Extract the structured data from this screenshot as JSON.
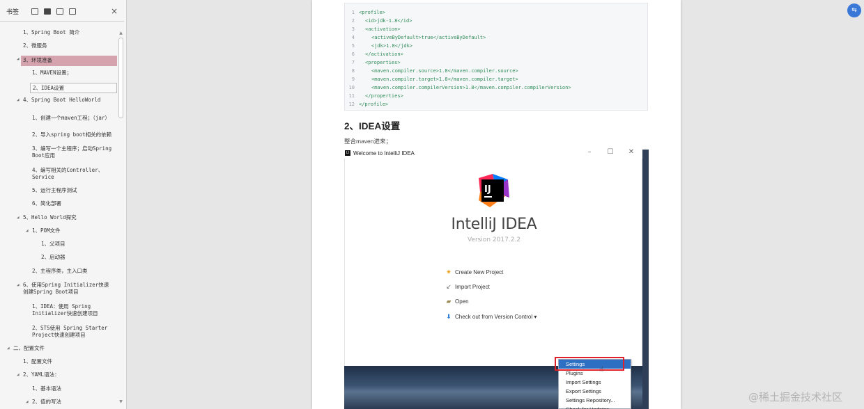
{
  "sidebar": {
    "title": "书签",
    "tools": [
      "expand-all-icon",
      "bookmark-icon",
      "add-bookmark-icon",
      "bookmark-options-icon"
    ],
    "close": "×",
    "bookmarks": [
      {
        "text": "1、Spring Boot 简介",
        "level": 2
      },
      {
        "text": "2、微服务",
        "level": 2
      },
      {
        "text": "3、环境准备",
        "level": 2,
        "selected": true,
        "toggle": true
      },
      {
        "text": "1、MAVEN设置；",
        "level": 3
      },
      {
        "text": "2、IDEA设置",
        "level": 3,
        "boxed": true
      },
      {
        "text": "4、Spring Boot HelloWorld",
        "level": 2,
        "toggle": true
      },
      {
        "text": "1、创建一个maven工程；（jar）",
        "level": 3
      },
      {
        "text": "2、导入spring boot相关的依赖",
        "level": 3
      },
      {
        "text": "3、编写一个主程序；启动Spring Boot应用",
        "level": 3
      },
      {
        "text": "4、编写相关的Controller、Service",
        "level": 3
      },
      {
        "text": "5、运行主程序测试",
        "level": 3
      },
      {
        "text": "6、简化部署",
        "level": 3
      },
      {
        "text": "5、Hello World探究",
        "level": 2,
        "toggle": true
      },
      {
        "text": "1、POM文件",
        "level": 3,
        "toggle": true
      },
      {
        "text": "1、父项目",
        "level": 4
      },
      {
        "text": "2、启动器",
        "level": 4
      },
      {
        "text": "2、主程序类，主入口类",
        "level": 3
      },
      {
        "text": "6、使用Spring Initializer快速创建Spring Boot项目",
        "level": 2,
        "toggle": true
      },
      {
        "text": "1、IDEA：使用 Spring Initializer快速创建项目",
        "level": 3
      },
      {
        "text": "2、STS使用 Spring Starter Project快速创建项目",
        "level": 3
      },
      {
        "text": "二、配置文件",
        "level": 1,
        "toggle": true
      },
      {
        "text": "1、配置文件",
        "level": 2
      },
      {
        "text": "2、YAML语法：",
        "level": 2,
        "toggle": true
      },
      {
        "text": "1、基本语法",
        "level": 3
      },
      {
        "text": "2、值的写法",
        "level": 3,
        "toggle": true
      }
    ]
  },
  "doc": {
    "code_lines": [
      {
        "n": "1",
        "t": "<profile>",
        "indent": 0
      },
      {
        "n": "2",
        "t": "<id>jdk-1.8</id>",
        "indent": 1
      },
      {
        "n": "3",
        "t": "<activation>",
        "indent": 1
      },
      {
        "n": "4",
        "t": "<activeByDefault>true</activeByDefault>",
        "indent": 2
      },
      {
        "n": "5",
        "t": "<jdk>1.8</jdk>",
        "indent": 2
      },
      {
        "n": "6",
        "t": "</activation>",
        "indent": 1
      },
      {
        "n": "7",
        "t": "<properties>",
        "indent": 1
      },
      {
        "n": "8",
        "t": "<maven.compiler.source>1.8</maven.compiler.source>",
        "indent": 2
      },
      {
        "n": "9",
        "t": "<maven.compiler.target>1.8</maven.compiler.target>",
        "indent": 2
      },
      {
        "n": "10",
        "t": "<maven.compiler.compilerVersion>1.8</maven.compiler.compilerVersion>",
        "indent": 2
      },
      {
        "n": "11",
        "t": "</properties>",
        "indent": 1
      },
      {
        "n": "12",
        "t": "</profile>",
        "indent": 0
      }
    ],
    "heading": "2、IDEA设置",
    "paragraph": "整合maven进来；"
  },
  "idea": {
    "window_title": "Welcome to IntelliJ IDEA",
    "logo_text": "IJ",
    "product_name": "IntelliJ IDEA",
    "version": "Version 2017.2.2",
    "actions": [
      {
        "icon": "sun-icon",
        "glyph": "✷",
        "color": "#e8a21a",
        "label": "Create New Project"
      },
      {
        "icon": "import-icon",
        "glyph": "↙",
        "color": "#666666",
        "label": "Import Project"
      },
      {
        "icon": "folder-icon",
        "glyph": "▰",
        "color": "#9a8a55",
        "label": "Open"
      },
      {
        "icon": "arrow-down-icon",
        "glyph": "⬇",
        "color": "#2f7ed8",
        "label": "Check out from Version Control ▾"
      }
    ],
    "menu": [
      "Settings",
      "Plugins",
      "Import Settings",
      "Export Settings",
      "Settings Repository...",
      "Check for Updates"
    ],
    "menu_highlight": "Settings",
    "colors": {
      "menu_highlight": "#2d6fc2",
      "red_box": "#e0202a",
      "selected_bookmark": "#d4a3ad"
    }
  },
  "watermark": "@稀土掘金技术社区",
  "float_button_icon": "translate-icon"
}
